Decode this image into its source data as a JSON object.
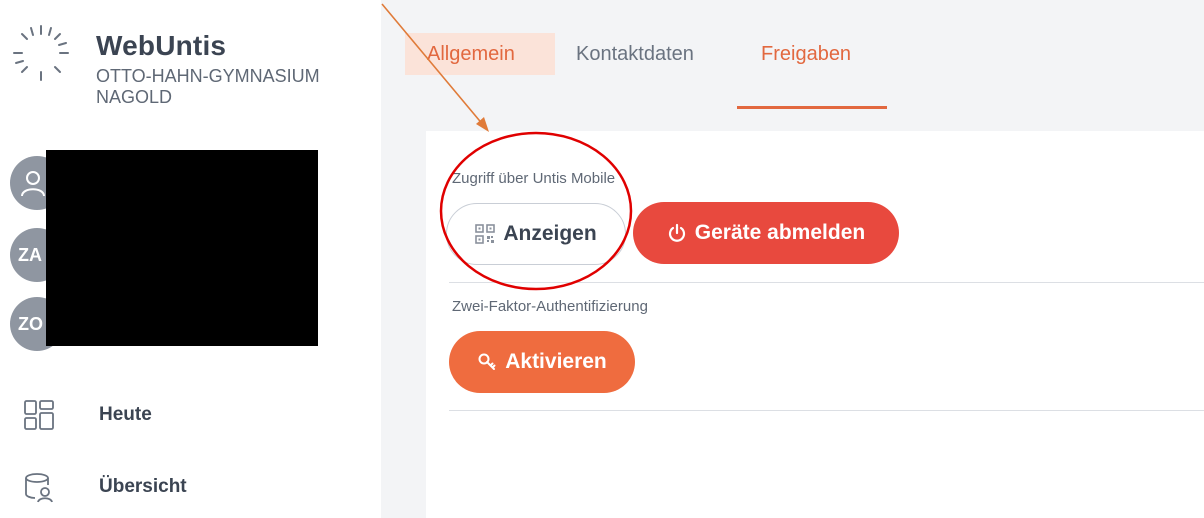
{
  "sidebar": {
    "brand": "WebUntis",
    "school_line1": "OTTO-HAHN-GYMNASIUM",
    "school_line2": "NAGOLD",
    "avatars": [
      "",
      "ZA",
      "ZO"
    ],
    "nav": [
      {
        "label": "Heute",
        "icon": "dashboard-icon"
      },
      {
        "label": "Übersicht",
        "icon": "overview-icon"
      }
    ]
  },
  "tabs": [
    {
      "label": "Allgemein",
      "active": false,
      "highlighted": true
    },
    {
      "label": "Kontaktdaten",
      "active": false
    },
    {
      "label": "Freigaben",
      "active": true
    }
  ],
  "sharing": {
    "mobile_label": "Zugriff über Untis Mobile",
    "show_button": "Anzeigen",
    "logout_button": "Geräte abmelden",
    "twofa_label": "Zwei-Faktor-Authentifizierung",
    "activate_button": "Aktivieren"
  },
  "colors": {
    "accent": "#e2683f",
    "danger": "#e8493e",
    "annotation": "#e00000",
    "arrow": "#e07b39"
  }
}
